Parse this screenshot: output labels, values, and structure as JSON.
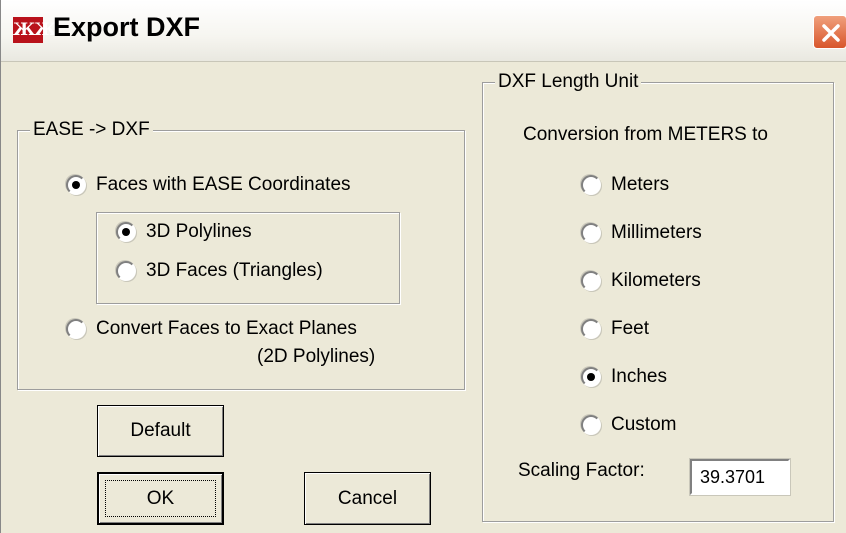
{
  "window": {
    "app_icon_text": "ЖЖ",
    "title": "Export DXF"
  },
  "ease_group": {
    "legend": "EASE -> DXF",
    "faces_ease": {
      "label": "Faces with EASE Coordinates",
      "checked": true
    },
    "polylines_3d": {
      "label": "3D Polylines",
      "checked": true
    },
    "faces_3d": {
      "label": "3D Faces (Triangles)",
      "checked": false
    },
    "exact_planes": {
      "label_line1": "Convert Faces to Exact Planes",
      "label_line2": "(2D Polylines)",
      "checked": false
    }
  },
  "unit_group": {
    "legend": "DXF Length Unit",
    "conversion_label": "Conversion from METERS to",
    "options": [
      {
        "label": "Meters",
        "checked": false
      },
      {
        "label": "Millimeters",
        "checked": false
      },
      {
        "label": "Kilometers",
        "checked": false
      },
      {
        "label": "Feet",
        "checked": false
      },
      {
        "label": "Inches",
        "checked": true
      },
      {
        "label": "Custom",
        "checked": false
      }
    ],
    "scaling_label": "Scaling Factor:",
    "scaling_value": "39.3701"
  },
  "buttons": {
    "default_label": "Default",
    "ok_label": "OK",
    "cancel_label": "Cancel"
  },
  "colors": {
    "dialog_bg": "#ece9d8",
    "close_button": "#d8562c",
    "app_icon": "#b9121b"
  }
}
